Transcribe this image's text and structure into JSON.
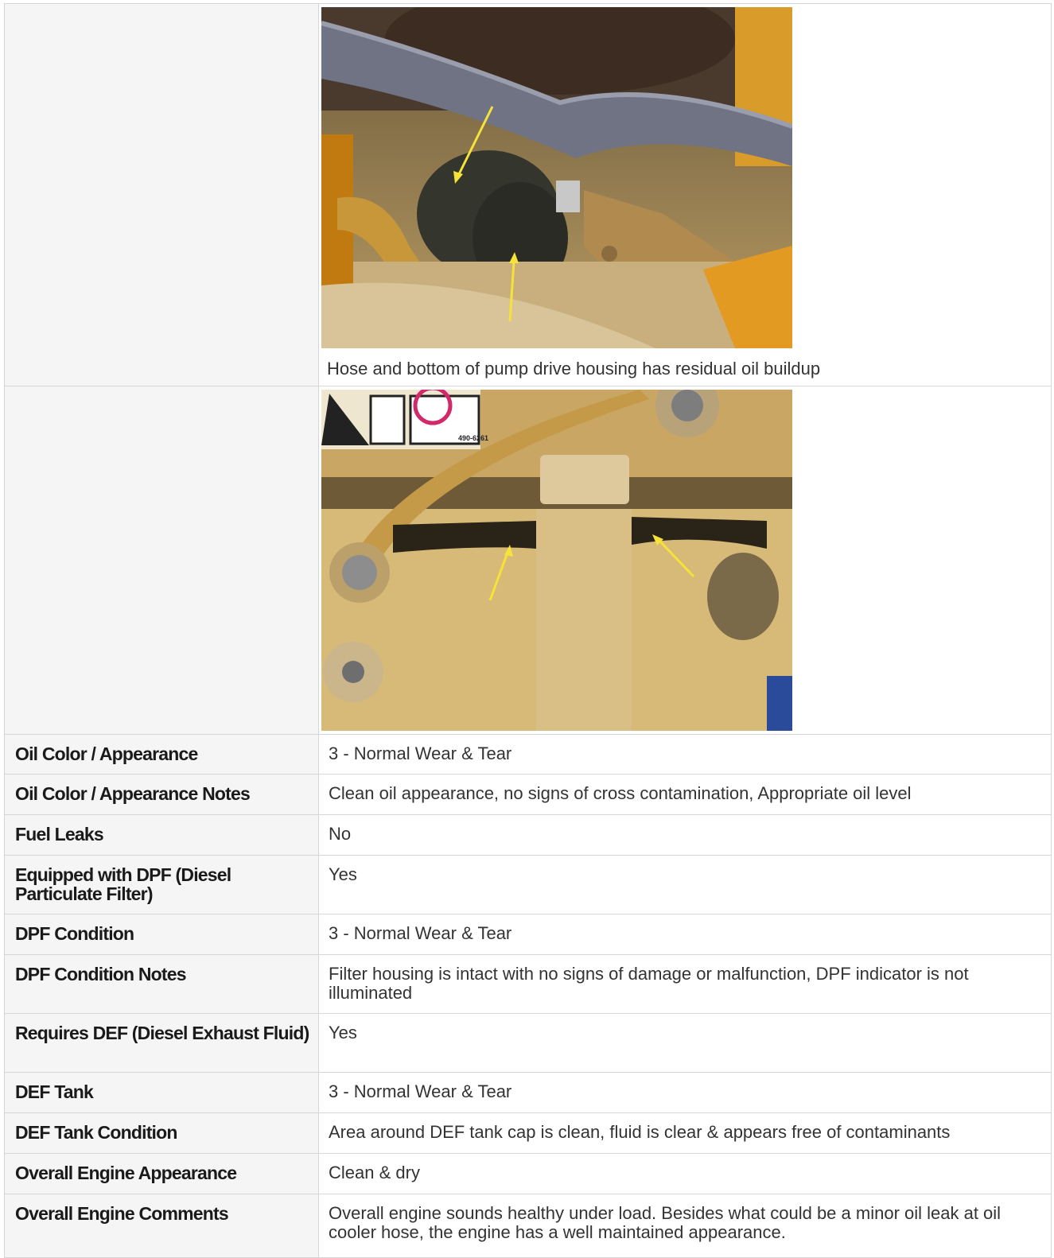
{
  "photos": [
    {
      "caption": "Hose and bottom of pump drive housing has residual oil buildup"
    },
    {
      "caption": "",
      "decal_code": "490-6261"
    }
  ],
  "rows": [
    {
      "label": "Oil Color / Appearance",
      "value": "3 - Normal Wear & Tear"
    },
    {
      "label": "Oil Color / Appearance Notes",
      "value": "Clean oil appearance, no signs of cross contamination, Appropriate oil level"
    },
    {
      "label": "Fuel Leaks",
      "value": "No"
    },
    {
      "label": "Equipped with DPF (Diesel Particulate Filter)",
      "value": "Yes"
    },
    {
      "label": "DPF Condition",
      "value": "3 - Normal Wear & Tear"
    },
    {
      "label": "DPF Condition Notes",
      "value": "Filter housing is intact with no signs of damage or malfunction, DPF indicator is not illuminated"
    },
    {
      "label": "Requires DEF (Diesel Exhaust Fluid)",
      "value": "Yes"
    },
    {
      "label": "DEF Tank",
      "value": "3 - Normal Wear & Tear"
    },
    {
      "label": "DEF Tank Condition",
      "value": "Area around DEF tank cap is clean, fluid is clear & appears free of contaminants"
    },
    {
      "label": "Overall Engine Appearance",
      "value": "Clean & dry"
    },
    {
      "label": "Overall Engine Comments",
      "value": "Overall engine sounds healthy under load. Besides what could be a minor oil leak at oil cooler hose, the engine has a well maintained appearance."
    }
  ]
}
